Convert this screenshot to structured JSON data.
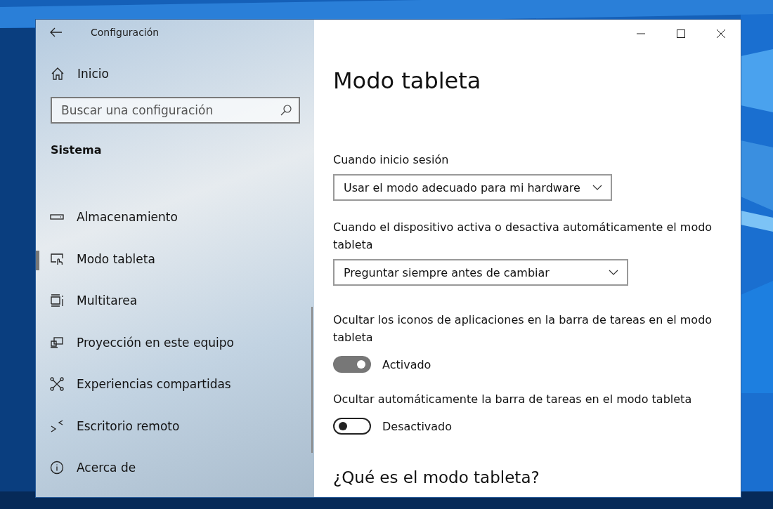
{
  "window": {
    "title": "Configuración"
  },
  "sidebar": {
    "home": "Inicio",
    "search": {
      "placeholder": "Buscar una configuración"
    },
    "section": "Sistema",
    "items": [
      {
        "kind": "storage",
        "label": "Almacenamiento",
        "selected": false
      },
      {
        "kind": "tablet",
        "label": "Modo tableta",
        "selected": true
      },
      {
        "kind": "multitask",
        "label": "Multitarea",
        "selected": false
      },
      {
        "kind": "project",
        "label": "Proyección en este equipo",
        "selected": false
      },
      {
        "kind": "shared",
        "label": "Experiencias compartidas",
        "selected": false
      },
      {
        "kind": "remote",
        "label": "Escritorio remoto",
        "selected": false
      },
      {
        "kind": "about",
        "label": "Acerca de",
        "selected": false
      }
    ]
  },
  "content": {
    "title": "Modo tableta",
    "settings": [
      {
        "kind": "dropdown",
        "label": "Cuando inicio sesión",
        "value": "Usar el modo adecuado para mi hardware"
      },
      {
        "kind": "dropdown",
        "label": "Cuando el dispositivo activa o desactiva automáticamente el modo tableta",
        "value": "Preguntar siempre antes de cambiar"
      },
      {
        "kind": "toggle",
        "label": "Ocultar los iconos de aplicaciones en la barra de tareas en el modo tableta",
        "on": true,
        "status": "Activado"
      },
      {
        "kind": "toggle",
        "label": "Ocultar automáticamente la barra de tareas en el modo tableta",
        "on": false,
        "status": "Desactivado"
      }
    ],
    "subheading": "¿Qué es el modo tableta?"
  }
}
